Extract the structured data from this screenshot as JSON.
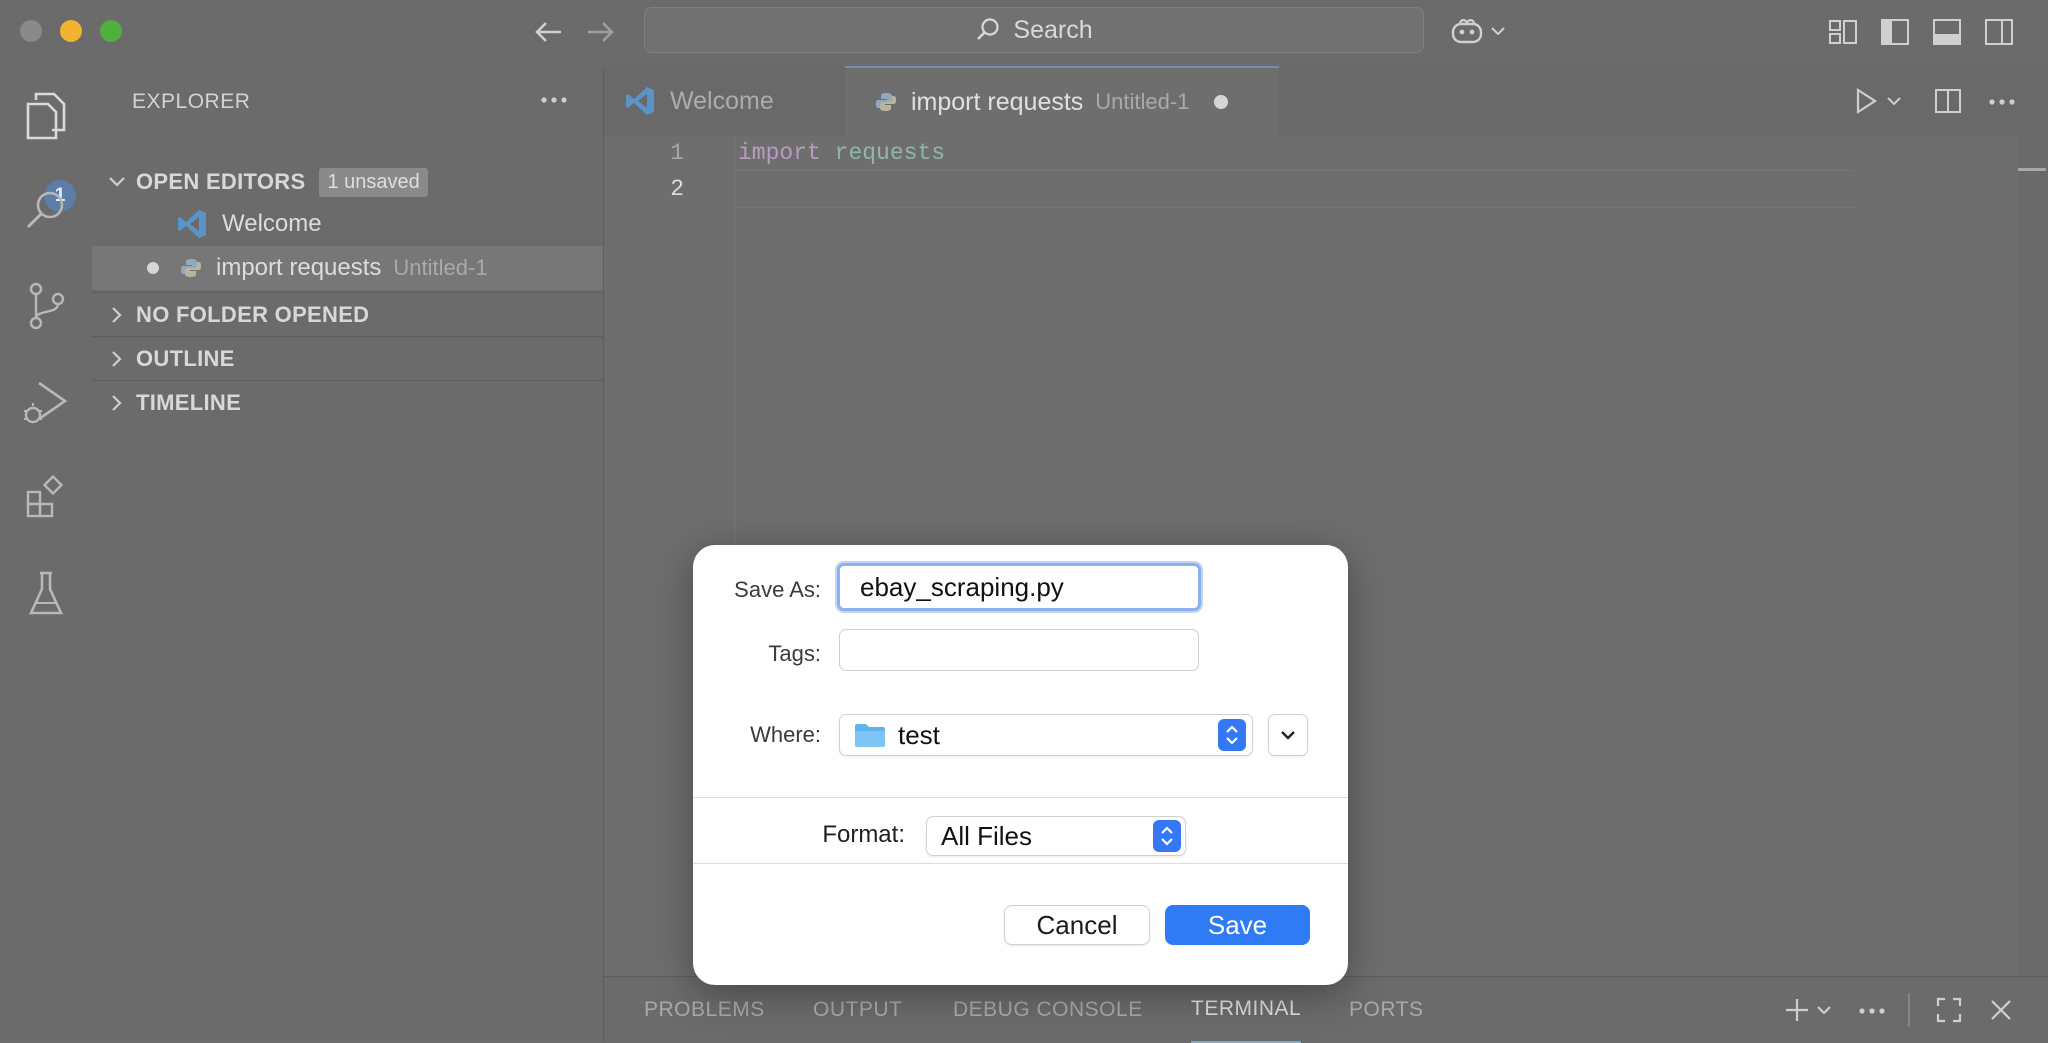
{
  "titlebar": {
    "search_placeholder": "Search"
  },
  "activity_bar": {
    "explorer_badge": "1"
  },
  "sidebar": {
    "title": "EXPLORER",
    "open_editors": {
      "label": "OPEN EDITORS",
      "badge": "1 unsaved",
      "items": [
        {
          "name": "Welcome",
          "detail": ""
        },
        {
          "name": "import requests",
          "detail": "Untitled-1"
        }
      ]
    },
    "sections": [
      "NO FOLDER OPENED",
      "OUTLINE",
      "TIMELINE"
    ]
  },
  "tabs": [
    {
      "label": "Welcome",
      "detail": ""
    },
    {
      "label": "import requests",
      "detail": "Untitled-1"
    }
  ],
  "editor": {
    "line_numbers": [
      "1",
      "2"
    ],
    "line1_keyword": "import",
    "line1_module": "requests"
  },
  "panel": {
    "tabs": [
      "PROBLEMS",
      "OUTPUT",
      "DEBUG CONSOLE",
      "TERMINAL",
      "PORTS"
    ],
    "active_tab": "TERMINAL"
  },
  "save_dialog": {
    "save_as_label": "Save As:",
    "save_as_value": "ebay_scraping.py",
    "tags_label": "Tags:",
    "tags_value": "",
    "where_label": "Where:",
    "where_value": "test",
    "format_label": "Format:",
    "format_value": "All Files",
    "cancel_label": "Cancel",
    "save_label": "Save"
  },
  "colors": {
    "accent_blue": "#3478f6",
    "badge_blue": "#5c7ea8",
    "keyword": "#b79cc0",
    "module": "#8fb7a8"
  }
}
